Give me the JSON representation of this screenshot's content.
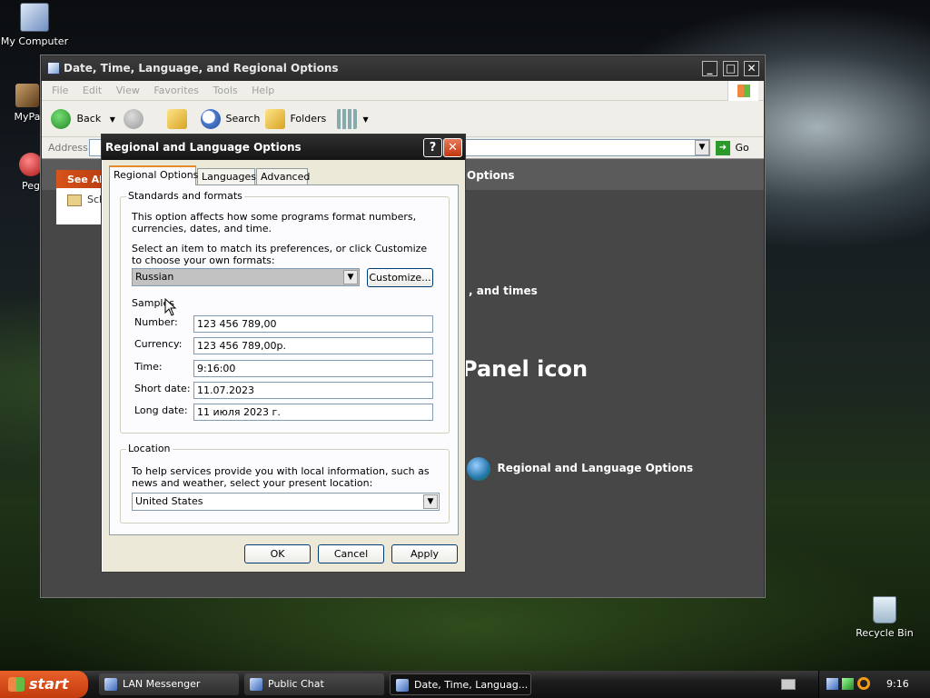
{
  "desktop": {
    "icons": [
      {
        "label": "My Computer"
      },
      {
        "label": "MyPa"
      },
      {
        "label": "Peg"
      },
      {
        "label": "Recycle Bin"
      }
    ]
  },
  "explorer": {
    "title": "Date, Time, Language, and Regional Options",
    "menu": [
      "File",
      "Edit",
      "View",
      "Favorites",
      "Tools",
      "Help"
    ],
    "toolbar": {
      "back": "Back",
      "search": "Search",
      "folders": "Folders"
    },
    "address_label": "Address",
    "go_label": "Go",
    "see_also": "See Al",
    "see_also_item": "Sch",
    "band_text": "Options",
    "task_text": ", and times",
    "panel_heading": "Panel icon",
    "panel_item": "Regional and Language Options"
  },
  "dialog": {
    "title": "Regional and Language Options",
    "help_button": "?",
    "close_button": "✕",
    "tabs": [
      "Regional Options",
      "Languages",
      "Advanced"
    ],
    "standards": {
      "label": "Standards and formats",
      "description": "This option affects how some programs format numbers, currencies, dates, and time.",
      "instruction": "Select an item to match its preferences, or click Customize to choose your own formats:",
      "selected_format": "Russian",
      "customize_button": "Customize..."
    },
    "samples": {
      "label": "Samples",
      "rows": [
        {
          "label": "Number:",
          "value": "123 456 789,00"
        },
        {
          "label": "Currency:",
          "value": "123 456 789,00р."
        },
        {
          "label": "Time:",
          "value": "9:16:00"
        },
        {
          "label": "Short date:",
          "value": "11.07.2023"
        },
        {
          "label": "Long date:",
          "value": "11 июля 2023 г."
        }
      ]
    },
    "location": {
      "label": "Location",
      "description": "To help services provide you with local information, such as news and weather, select your present location:",
      "selected": "United States"
    },
    "buttons": {
      "ok": "OK",
      "cancel": "Cancel",
      "apply": "Apply"
    }
  },
  "taskbar": {
    "start": "start",
    "tasks": [
      "LAN Messenger",
      "Public Chat",
      "Date, Time, Languag..."
    ],
    "clock": "9:16"
  }
}
